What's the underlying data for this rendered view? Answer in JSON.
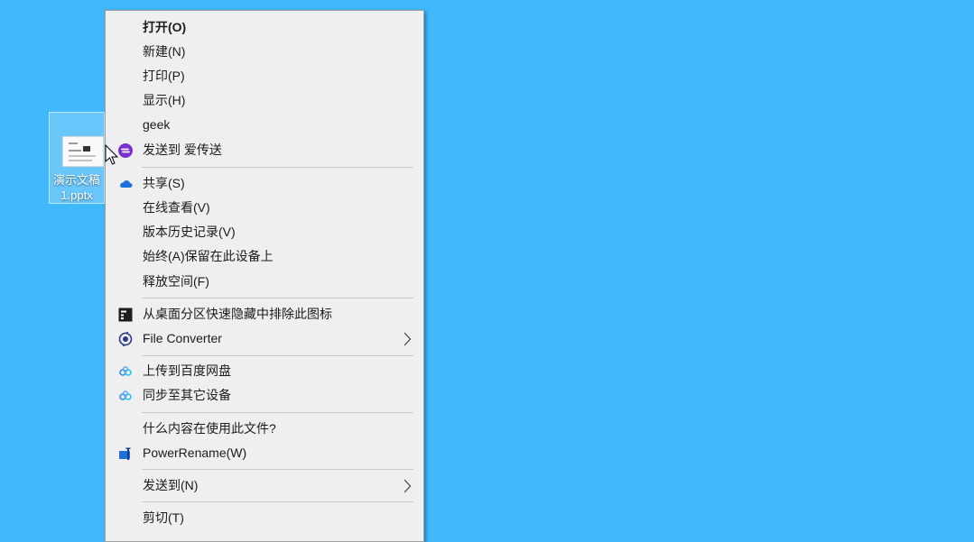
{
  "desktop": {
    "background": "#41b8fb",
    "file_icon": {
      "label_line1": "演示文稿",
      "label_line2": "1.pptx",
      "icon": "pptx-thumbnail-icon"
    }
  },
  "context_menu": {
    "items": [
      {
        "label": "打开(O)",
        "bold": true
      },
      {
        "label": "新建(N)"
      },
      {
        "label": "打印(P)"
      },
      {
        "label": "显示(H)"
      },
      {
        "label": "geek"
      },
      {
        "label": "发送到 爱传送",
        "icon": "aichuansong-icon"
      },
      {
        "label": "共享(S)",
        "icon": "onedrive-cloud-icon"
      },
      {
        "label": "在线查看(V)"
      },
      {
        "label": "版本历史记录(V)"
      },
      {
        "label": "始终(A)保留在此设备上"
      },
      {
        "label": "释放空间(F)"
      },
      {
        "label": "从桌面分区快速隐藏中排除此图标",
        "icon": "fences-icon"
      },
      {
        "label": "File Converter",
        "icon": "file-converter-icon",
        "submenu": true
      },
      {
        "label": "上传到百度网盘",
        "icon": "baidu-netdisk-icon"
      },
      {
        "label": "同步至其它设备",
        "icon": "baidu-netdisk-icon"
      },
      {
        "label": "什么内容在使用此文件?"
      },
      {
        "label": "PowerRename(W)",
        "icon": "powerrename-icon"
      },
      {
        "label": "发送到(N)",
        "submenu": true
      },
      {
        "label": "剪切(T)"
      }
    ]
  }
}
